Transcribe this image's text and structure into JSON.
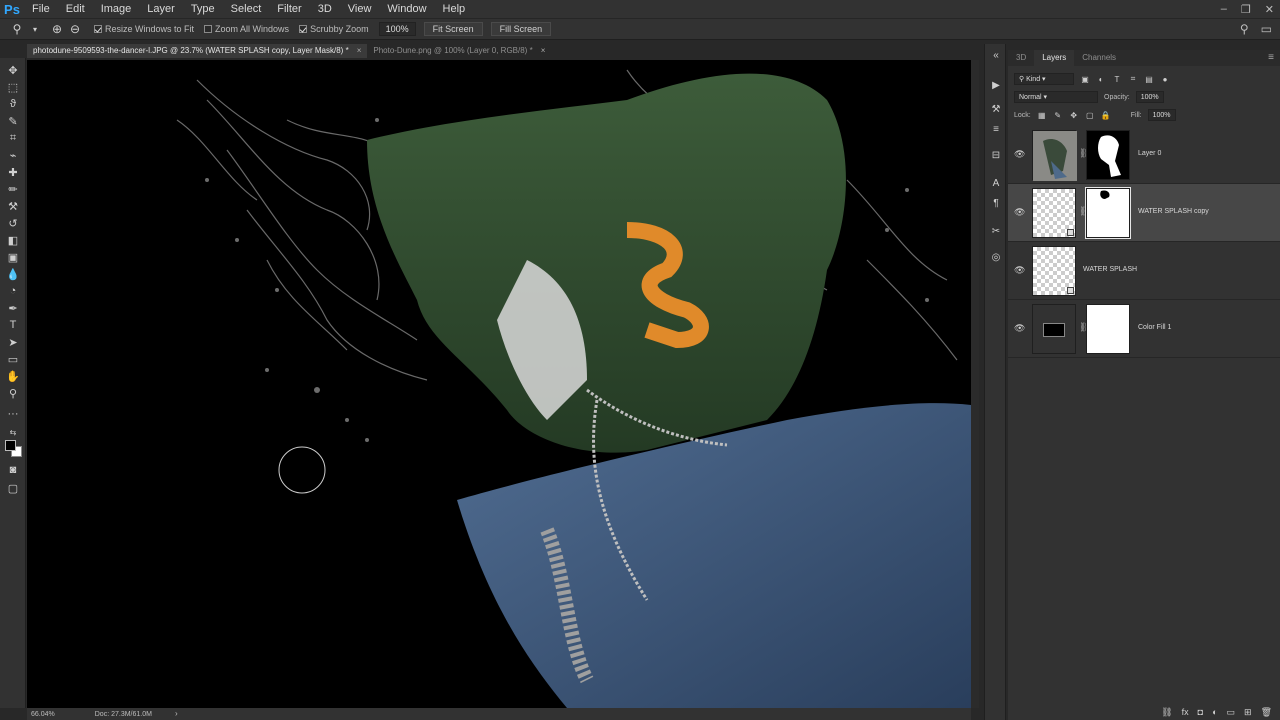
{
  "menubar": {
    "logo": "Ps",
    "items": [
      "File",
      "Edit",
      "Image",
      "Layer",
      "Type",
      "Select",
      "Filter",
      "3D",
      "View",
      "Window",
      "Help"
    ]
  },
  "options": {
    "resize_windows": "Resize Windows to Fit",
    "zoom_all_windows": "Zoom All Windows",
    "scrubby_zoom": "Scrubby Zoom",
    "zoom_value": "100%",
    "fit_screen": "Fit Screen",
    "fill_screen": "Fill Screen"
  },
  "tabs": [
    {
      "title": "photodune-9509593-the-dancer-l.JPG @ 23.7% (WATER SPLASH copy, Layer Mask/8) *",
      "close": "×"
    },
    {
      "title": "Photo-Dune.png @ 100% (Layer 0, RGB/8) *",
      "close": "×"
    }
  ],
  "status": {
    "zoom": "66.04%",
    "doc": "Doc: 27.3M/61.0M",
    "arrow": "›"
  },
  "panel": {
    "tabs": [
      "3D",
      "Layers",
      "Channels"
    ],
    "active_tab": "Layers",
    "menu_icon": "≡",
    "filter_kind": "Kind",
    "blend_mode": "Normal",
    "opacity_label": "Opacity:",
    "opacity_value": "100%",
    "lock_label": "Lock:",
    "fill_label": "Fill:",
    "fill_value": "100%"
  },
  "layers": [
    {
      "name": "Layer 0",
      "visible": true,
      "type": "image",
      "mask": "white-silhouette-on-black",
      "selected": false
    },
    {
      "name": "WATER SPLASH copy",
      "visible": true,
      "type": "smart",
      "mask": "white-with-black-patch",
      "selected": true
    },
    {
      "name": "WATER SPLASH",
      "visible": true,
      "type": "smart",
      "mask": null,
      "selected": false
    },
    {
      "name": "Color Fill 1",
      "visible": true,
      "type": "fill",
      "mask": "white",
      "selected": false
    }
  ],
  "footer_icons": [
    "link-icon",
    "fx-icon",
    "add-mask-icon",
    "adjustment-icon",
    "group-icon",
    "new-layer-icon",
    "delete-icon"
  ],
  "colors": {
    "foreground": "#000000",
    "background": "#ffffff",
    "ui_dark": "#323232",
    "selected_row": "#474747",
    "hoodie_green": "#2f4a2f",
    "jeans_blue": "#3c5577"
  }
}
